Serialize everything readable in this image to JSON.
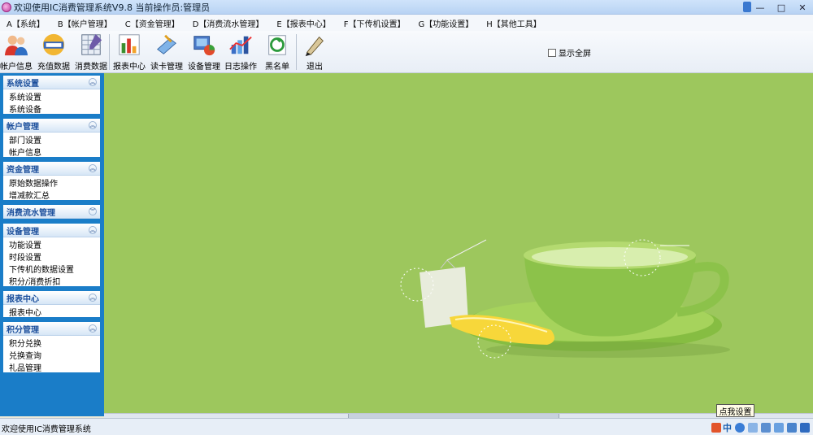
{
  "window": {
    "title": "欢迎使用IC消费管理系统V9.8 当前操作员:管理员",
    "controls": {
      "minimize": "—",
      "maximize": "□",
      "close": "✕"
    }
  },
  "menu": [
    "A【系统】",
    "B【帐户管理】",
    "C【资金管理】",
    "D【消费流水管理】",
    "E【报表中心】",
    "F【下传机设置】",
    "G【功能设置】",
    "H【其他工具】"
  ],
  "toolbar": {
    "buttons": [
      {
        "label": "帐户信息",
        "icon": "users-icon"
      },
      {
        "label": "充值数据",
        "icon": "recharge-card-icon"
      },
      {
        "label": "消费数据",
        "icon": "spreadsheet-icon"
      },
      {
        "label": "报表中心",
        "icon": "bar-chart-icon"
      },
      {
        "label": "读卡管理",
        "icon": "card-reader-icon"
      },
      {
        "label": "设备管理",
        "icon": "device-icon"
      },
      {
        "label": "日志操作",
        "icon": "log-chart-icon"
      },
      {
        "label": "黑名单",
        "icon": "blacklist-icon"
      },
      {
        "label": "退出",
        "icon": "exit-pen-icon"
      }
    ],
    "fullscreen_label": "显示全屏"
  },
  "sidebar": {
    "groups": [
      {
        "title": "系统设置",
        "chevron": "︽",
        "items": [
          "系统设置",
          "系统设备"
        ]
      },
      {
        "title": "帐户管理",
        "chevron": "︽",
        "items": [
          "部门设置",
          "帐户信息"
        ]
      },
      {
        "title": "资金管理",
        "chevron": "︽",
        "items": [
          "原始数据操作",
          "增减款汇总"
        ]
      },
      {
        "title": "消费流水管理",
        "chevron": "︾",
        "items": []
      },
      {
        "title": "设备管理",
        "chevron": "︽",
        "items": [
          "功能设置",
          "时段设置",
          "下传机的数据设置",
          "积分/消费折扣"
        ]
      },
      {
        "title": "报表中心",
        "chevron": "︽",
        "items": [
          "报表中心"
        ]
      },
      {
        "title": "积分管理",
        "chevron": "︽",
        "items": [
          "积分兑换",
          "兑换查询",
          "礼品管理"
        ]
      }
    ]
  },
  "main": {
    "background": "#9dc75d",
    "cup_color": "#8cc24a",
    "lemon_color": "#f7d73a"
  },
  "status": {
    "text": "欢迎使用IC消费管理系统",
    "tooltip": "点我设置",
    "ime_label": "中"
  }
}
